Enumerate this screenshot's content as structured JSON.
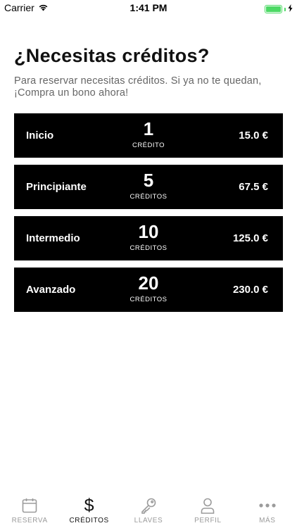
{
  "status_bar": {
    "carrier": "Carrier",
    "time": "1:41 PM",
    "battery_level": 1.0
  },
  "header": {
    "title": "¿Necesitas créditos?",
    "subtitle": "Para reservar necesitas créditos. Si ya no te quedan, ¡Compra un bono ahora!"
  },
  "packages": [
    {
      "name": "Inicio",
      "credits": "1",
      "unit": "CRÉDITO",
      "price": "15.0 €"
    },
    {
      "name": "Principiante",
      "credits": "5",
      "unit": "CRÉDITOS",
      "price": "67.5 €"
    },
    {
      "name": "Intermedio",
      "credits": "10",
      "unit": "CRÉDITOS",
      "price": "125.0 €"
    },
    {
      "name": "Avanzado",
      "credits": "20",
      "unit": "CRÉDITOS",
      "price": "230.0 €"
    }
  ],
  "tab_bar": {
    "items": [
      {
        "label": "RESERVA",
        "icon": "calendar-icon",
        "active": false
      },
      {
        "label": "CRÉDITOS",
        "icon": "dollar-icon",
        "active": true
      },
      {
        "label": "LLAVES",
        "icon": "key-icon",
        "active": false
      },
      {
        "label": "PERFIL",
        "icon": "person-icon",
        "active": false
      },
      {
        "label": "MÁS",
        "icon": "more-icon",
        "active": false
      }
    ],
    "active_color": "#111111",
    "inactive_color": "#9b9b9b"
  },
  "colors": {
    "card_background": "#000000",
    "battery": "#4cd964"
  }
}
